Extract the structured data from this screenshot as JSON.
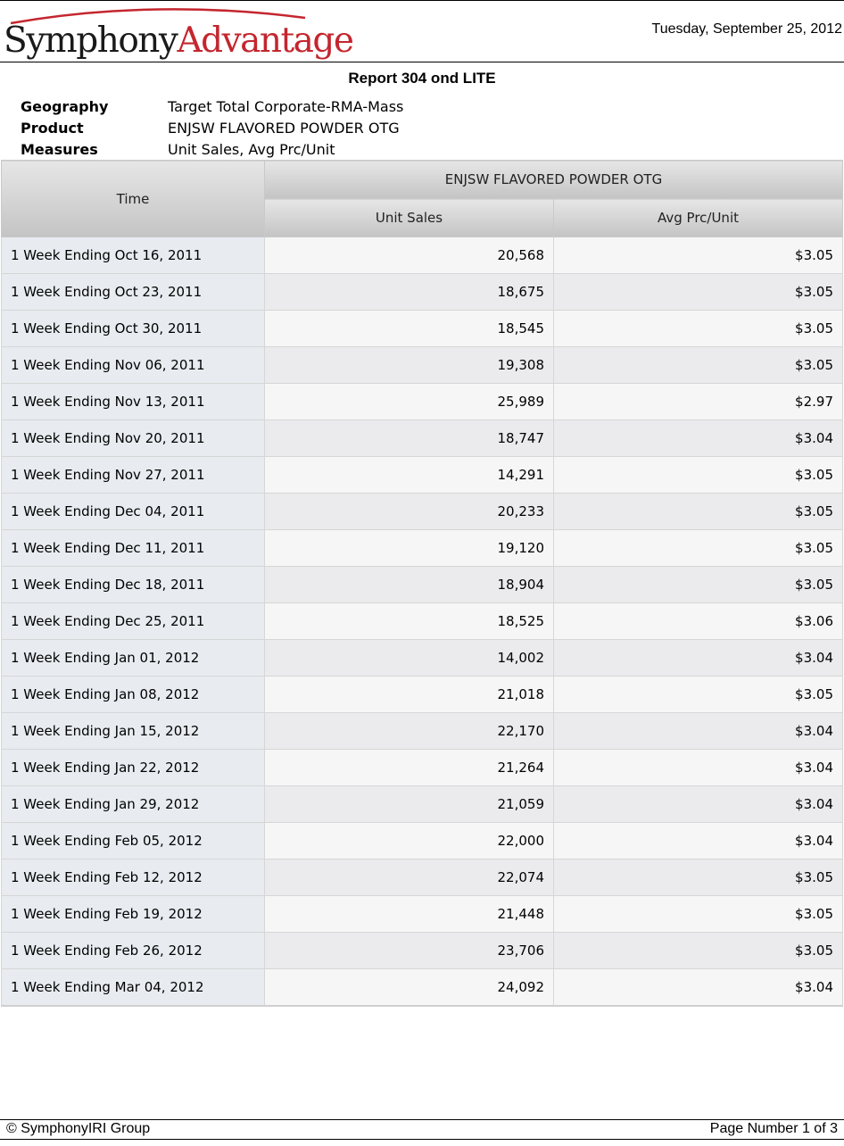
{
  "header": {
    "logo_part1": "Symphony",
    "logo_part2": "Advantage",
    "date": "Tuesday, September 25, 2012"
  },
  "report": {
    "title": "Report 304 ond LITE",
    "meta": [
      {
        "key": "Geography",
        "value": "Target Total Corporate-RMA-Mass"
      },
      {
        "key": "Product",
        "value": "ENJSW FLAVORED POWDER OTG"
      },
      {
        "key": "Measures",
        "value": "Unit Sales, Avg Prc/Unit"
      }
    ]
  },
  "table": {
    "time_header": "Time",
    "product_header": "ENJSW FLAVORED POWDER OTG",
    "measure_headers": [
      "Unit Sales",
      "Avg Prc/Unit"
    ],
    "rows": [
      {
        "time": "1 Week Ending Oct 16, 2011",
        "unit_sales": "20,568",
        "avg_price": "$3.05"
      },
      {
        "time": "1 Week Ending Oct 23, 2011",
        "unit_sales": "18,675",
        "avg_price": "$3.05"
      },
      {
        "time": "1 Week Ending Oct 30, 2011",
        "unit_sales": "18,545",
        "avg_price": "$3.05"
      },
      {
        "time": "1 Week Ending Nov 06, 2011",
        "unit_sales": "19,308",
        "avg_price": "$3.05"
      },
      {
        "time": "1 Week Ending Nov 13, 2011",
        "unit_sales": "25,989",
        "avg_price": "$2.97"
      },
      {
        "time": "1 Week Ending Nov 20, 2011",
        "unit_sales": "18,747",
        "avg_price": "$3.04"
      },
      {
        "time": "1 Week Ending Nov 27, 2011",
        "unit_sales": "14,291",
        "avg_price": "$3.05"
      },
      {
        "time": "1 Week Ending Dec 04, 2011",
        "unit_sales": "20,233",
        "avg_price": "$3.05"
      },
      {
        "time": "1 Week Ending Dec 11, 2011",
        "unit_sales": "19,120",
        "avg_price": "$3.05"
      },
      {
        "time": "1 Week Ending Dec 18, 2011",
        "unit_sales": "18,904",
        "avg_price": "$3.05"
      },
      {
        "time": "1 Week Ending Dec 25, 2011",
        "unit_sales": "18,525",
        "avg_price": "$3.06"
      },
      {
        "time": "1 Week Ending Jan 01, 2012",
        "unit_sales": "14,002",
        "avg_price": "$3.04"
      },
      {
        "time": "1 Week Ending Jan 08, 2012",
        "unit_sales": "21,018",
        "avg_price": "$3.05"
      },
      {
        "time": "1 Week Ending Jan 15, 2012",
        "unit_sales": "22,170",
        "avg_price": "$3.04"
      },
      {
        "time": "1 Week Ending Jan 22, 2012",
        "unit_sales": "21,264",
        "avg_price": "$3.04"
      },
      {
        "time": "1 Week Ending Jan 29, 2012",
        "unit_sales": "21,059",
        "avg_price": "$3.04"
      },
      {
        "time": "1 Week Ending Feb 05, 2012",
        "unit_sales": "22,000",
        "avg_price": "$3.04"
      },
      {
        "time": "1 Week Ending Feb 12, 2012",
        "unit_sales": "22,074",
        "avg_price": "$3.05"
      },
      {
        "time": "1 Week Ending Feb 19, 2012",
        "unit_sales": "21,448",
        "avg_price": "$3.05"
      },
      {
        "time": "1 Week Ending Feb 26, 2012",
        "unit_sales": "23,706",
        "avg_price": "$3.05"
      },
      {
        "time": "1 Week Ending Mar 04, 2012",
        "unit_sales": "24,092",
        "avg_price": "$3.04"
      }
    ]
  },
  "footer": {
    "copyright": "© SymphonyIRI Group",
    "page_number": "Page Number 1 of 3"
  },
  "colors": {
    "logo_red": "#c4262e",
    "header_gray": "#d4d4d4",
    "time_cell_bg": "#e8ecf0"
  }
}
